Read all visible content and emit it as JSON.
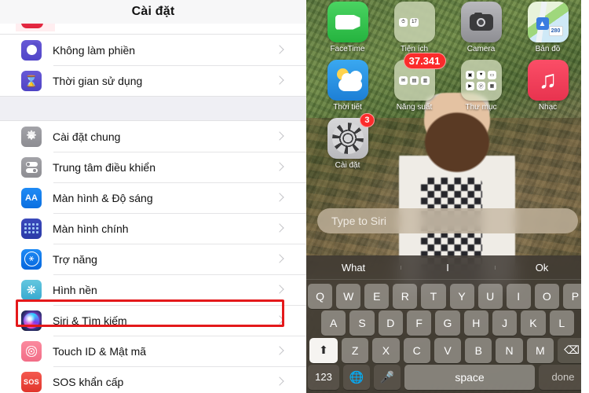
{
  "settings": {
    "nav_title": "Cài đặt",
    "groups": [
      {
        "rows": [
          {
            "label": "Không làm phiền",
            "icon": "moon-icon",
            "icon_class": "ic-moon"
          },
          {
            "label": "Thời gian sử dụng",
            "icon": "hourglass-icon",
            "icon_class": "ic-hour",
            "glyph": "⌛"
          }
        ]
      },
      {
        "rows": [
          {
            "label": "Cài đặt chung",
            "icon": "gear-icon",
            "icon_class": "ic-gear"
          },
          {
            "label": "Trung tâm điều khiển",
            "icon": "control-center-icon",
            "icon_class": "ic-ctrl"
          },
          {
            "label": "Màn hình & Độ sáng",
            "icon": "display-brightness-icon",
            "icon_class": "ic-aa",
            "glyph": "AA"
          },
          {
            "label": "Màn hình chính",
            "icon": "home-screen-icon",
            "icon_class": "ic-home"
          },
          {
            "label": "Trợ năng",
            "icon": "accessibility-icon",
            "icon_class": "ic-acc"
          },
          {
            "label": "Hình nền",
            "icon": "wallpaper-icon",
            "icon_class": "ic-wall"
          },
          {
            "label": "Siri & Tìm kiếm",
            "icon": "siri-icon",
            "icon_class": "ic-siri",
            "highlighted": true
          },
          {
            "label": "Touch ID & Mật mã",
            "icon": "touch-id-icon",
            "icon_class": "ic-touch"
          },
          {
            "label": "SOS khẩn cấp",
            "icon": "sos-icon",
            "icon_class": "ic-sos",
            "glyph": "SOS"
          }
        ]
      }
    ],
    "highlight_color": "#e4191b"
  },
  "phone": {
    "apps": [
      {
        "label": "FaceTime",
        "icon": "facetime-icon",
        "type": "app",
        "style": "ap-facetime"
      },
      {
        "label": "Tiện ích",
        "icon": "utilities-folder-icon",
        "type": "folder",
        "mini": [
          "⏱",
          "17"
        ]
      },
      {
        "label": "Camera",
        "icon": "camera-icon",
        "type": "camera",
        "style": "ap-camera"
      },
      {
        "label": "Bản đồ",
        "icon": "maps-icon",
        "type": "maps",
        "style": "ap-maps",
        "road_label": "280"
      },
      {
        "label": "Thời tiết",
        "icon": "weather-icon",
        "type": "weather",
        "style": "ap-weather"
      },
      {
        "label": "Năng suất",
        "icon": "productivity-folder-icon",
        "type": "folder",
        "badge": "37.341",
        "mini": [
          "✉",
          "▤",
          "▥"
        ]
      },
      {
        "label": "Thư mục",
        "icon": "folder-icon",
        "type": "folder",
        "mini": [
          "▣",
          "♥",
          "▭",
          "▶",
          "ⓟ",
          "▦"
        ]
      },
      {
        "label": "Nhạc",
        "icon": "music-icon",
        "type": "app",
        "style": "ap-music"
      },
      {
        "label": "Cài đặt",
        "icon": "settings-icon",
        "type": "settings",
        "badge": "3"
      }
    ],
    "siri": {
      "placeholder": "Type to Siri"
    },
    "keyboard": {
      "suggestions": [
        "What",
        "I",
        "Ok"
      ],
      "row1": [
        "Q",
        "W",
        "E",
        "R",
        "T",
        "Y",
        "U",
        "I",
        "O",
        "P"
      ],
      "row2": [
        "A",
        "S",
        "D",
        "F",
        "G",
        "H",
        "J",
        "K",
        "L"
      ],
      "row3": [
        "Z",
        "X",
        "C",
        "V",
        "B",
        "N",
        "M"
      ],
      "shift_label": "⬆",
      "backspace_label": "⌫",
      "numbers_label": "123",
      "globe_label": "🌐",
      "mic_label": "🎤",
      "space_label": "space",
      "done_label": "done"
    }
  }
}
